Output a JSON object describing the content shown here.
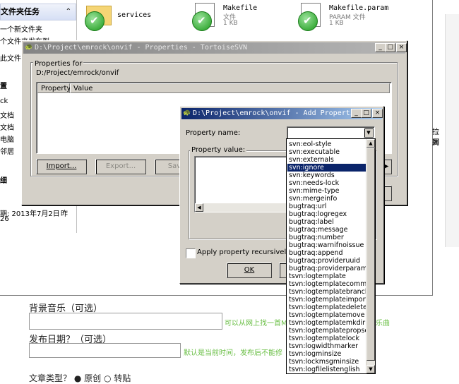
{
  "explorer": {
    "task_pane": {
      "header1": "文件夹任务",
      "items1": [
        "一个新文件夹",
        "个文件夹发布到",
        "此文件"
      ],
      "header2": "置",
      "items2": [
        "ck",
        "文档",
        "文档",
        "电脑",
        "邻居"
      ],
      "header3": "细",
      "details": [
        "期: 2013年7月2日",
        "26"
      ],
      "details_suffix": "昨"
    },
    "files": [
      {
        "name": "services",
        "type": "",
        "size": ""
      },
      {
        "name": "Makefile",
        "type": "文件",
        "size": "1 KB"
      },
      {
        "name": "Makefile.param",
        "type": "PARAM 文件",
        "size": "1 KB"
      }
    ],
    "right_edge": [
      "拉列",
      "属"
    ]
  },
  "web_form": {
    "music_label": "背景音乐（可选）",
    "music_hint": "可以从网上找一首M",
    "music_hint_tail": "乐曲",
    "date_label": "发布日期？（可选）",
    "date_hint": "默认是当前时间，发布后不能修",
    "type_label": "文章类型？",
    "type_option1": "原创",
    "type_option2": "转贴"
  },
  "properties_dialog": {
    "title": "D:\\Project\\emrock\\onvif - Properties - TortoiseSVN",
    "properties_for_label": "Properties for",
    "path": "D:/Project/emrock/onvif",
    "columns": [
      "Property",
      "Value"
    ],
    "import_button": "Import...",
    "export_button": "Export...",
    "save_button": "Save"
  },
  "add_dialog": {
    "title": "D:\\Project\\emrock\\onvif - Add Properties ...",
    "property_name_label": "Property name:",
    "property_value_label": "Property value:",
    "apply_recursively_label": "Apply property recursively",
    "ok_button": "OK",
    "selected_property": "svn:ignore",
    "options": [
      "svn:eol-style",
      "svn:executable",
      "svn:externals",
      "svn:ignore",
      "svn:keywords",
      "svn:needs-lock",
      "svn:mime-type",
      "svn:mergeinfo",
      "bugtraq:url",
      "bugtraq:logregex",
      "bugtraq:label",
      "bugtraq:message",
      "bugtraq:number",
      "bugtraq:warnifnoissue",
      "bugtraq:append",
      "bugtraq:provideruuid",
      "bugtraq:providerparams",
      "tsvn:logtemplate",
      "tsvn:logtemplatecommit",
      "tsvn:logtemplatebranch",
      "tsvn:logtemplateimport",
      "tsvn:logtemplatedelete",
      "tsvn:logtemplatemove",
      "tsvn:logtemplatemkdir",
      "tsvn:logtemplatepropset",
      "tsvn:logtemplatelock",
      "tsvn:logwidthmarker",
      "tsvn:logminsize",
      "tsvn:lockmsgminsize",
      "tsvn:logfilelistenglish"
    ]
  },
  "colors": {
    "selection": "#0a246a",
    "dialog_face": "#d4d0c8",
    "hint_green": "#6abf45"
  },
  "icons": {
    "window_min": "_",
    "window_max": "□",
    "window_close": "×",
    "dropdown": "▼"
  }
}
